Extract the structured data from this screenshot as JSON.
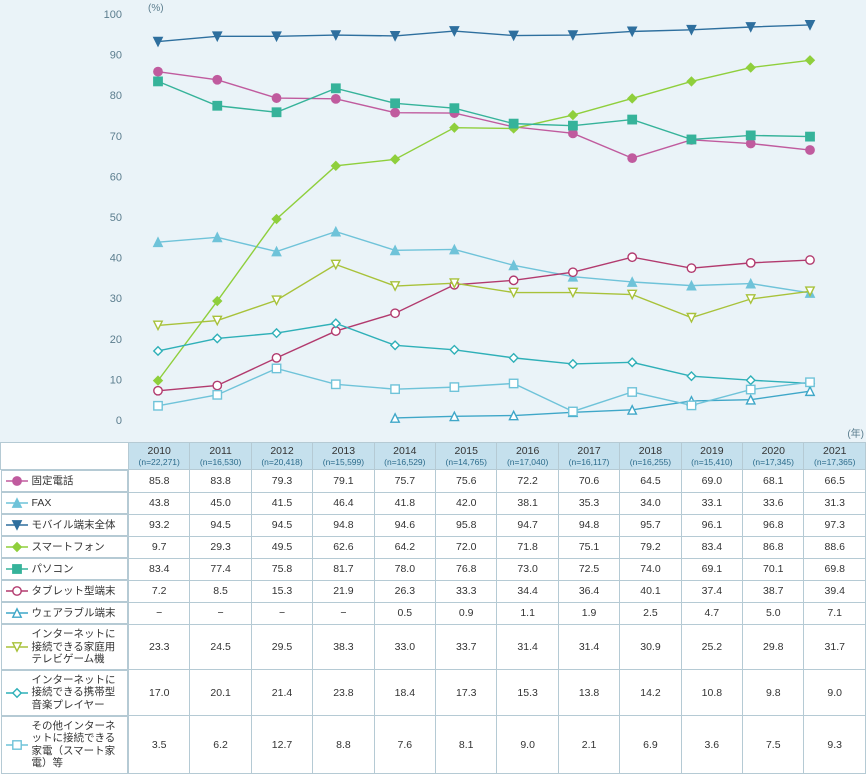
{
  "chart_data": {
    "type": "line",
    "title": "",
    "xlabel": "(年)",
    "ylabel": "(%)",
    "ylim": [
      0,
      100
    ],
    "yticks": [
      0,
      10,
      20,
      30,
      40,
      50,
      60,
      70,
      80,
      90,
      100
    ],
    "categories": [
      "2010",
      "2011",
      "2012",
      "2013",
      "2014",
      "2015",
      "2016",
      "2017",
      "2018",
      "2019",
      "2020",
      "2021"
    ],
    "n": [
      "(n=22,271)",
      "(n=16,530)",
      "(n=20,418)",
      "(n=15,599)",
      "(n=16,529)",
      "(n=14,765)",
      "(n=17,040)",
      "(n=16,117)",
      "(n=16,255)",
      "(n=15,410)",
      "(n=17,345)",
      "(n=17,365)"
    ],
    "series": [
      {
        "name": "固定電話",
        "color": "#c05b9e",
        "marker": "circle-solid",
        "values": [
          85.8,
          83.8,
          79.3,
          79.1,
          75.7,
          75.6,
          72.2,
          70.6,
          64.5,
          69.0,
          68.1,
          66.5
        ]
      },
      {
        "name": "FAX",
        "color": "#6fc3d9",
        "marker": "tri-solid",
        "values": [
          43.8,
          45.0,
          41.5,
          46.4,
          41.8,
          42.0,
          38.1,
          35.3,
          34.0,
          33.1,
          33.6,
          31.3
        ]
      },
      {
        "name": "モバイル端末全体",
        "color": "#2e6f9e",
        "marker": "tri-down-solid",
        "values": [
          93.2,
          94.5,
          94.5,
          94.8,
          94.6,
          95.8,
          94.7,
          94.8,
          95.7,
          96.1,
          96.8,
          97.3
        ]
      },
      {
        "name": "スマートフォン",
        "color": "#8fcf3c",
        "marker": "diamond-solid",
        "values": [
          9.7,
          29.3,
          49.5,
          62.6,
          64.2,
          72.0,
          71.8,
          75.1,
          79.2,
          83.4,
          86.8,
          88.6
        ]
      },
      {
        "name": "パソコン",
        "color": "#36b39a",
        "marker": "square-solid",
        "values": [
          83.4,
          77.4,
          75.8,
          81.7,
          78.0,
          76.8,
          73.0,
          72.5,
          74.0,
          69.1,
          70.1,
          69.8
        ]
      },
      {
        "name": "タブレット型端末",
        "color": "#b23a6e",
        "marker": "circle-open",
        "values": [
          7.2,
          8.5,
          15.3,
          21.9,
          26.3,
          33.3,
          34.4,
          36.4,
          40.1,
          37.4,
          38.7,
          39.4
        ]
      },
      {
        "name": "ウェアラブル端末",
        "color": "#3fa7c8",
        "marker": "tri-open",
        "values": [
          null,
          null,
          null,
          null,
          0.5,
          0.9,
          1.1,
          1.9,
          2.5,
          4.7,
          5.0,
          7.1
        ]
      },
      {
        "name": "インターネットに接続できる家庭用テレビゲーム機",
        "color": "#a8c23a",
        "marker": "tri-down-open",
        "values": [
          23.3,
          24.5,
          29.5,
          38.3,
          33.0,
          33.7,
          31.4,
          31.4,
          30.9,
          25.2,
          29.8,
          31.7
        ]
      },
      {
        "name": "インターネットに接続できる携帯型音楽プレイヤー",
        "color": "#2fb0b8",
        "marker": "diamond-open",
        "values": [
          17.0,
          20.1,
          21.4,
          23.8,
          18.4,
          17.3,
          15.3,
          13.8,
          14.2,
          10.8,
          9.8,
          9.0
        ]
      },
      {
        "name": "その他インターネットに接続できる家電（スマート家電）等",
        "color": "#6fc3d9",
        "marker": "square-open",
        "values": [
          3.5,
          6.2,
          12.7,
          8.8,
          7.6,
          8.1,
          9.0,
          2.1,
          6.9,
          3.6,
          7.5,
          9.3
        ]
      }
    ]
  },
  "table": {
    "dash": "−"
  }
}
